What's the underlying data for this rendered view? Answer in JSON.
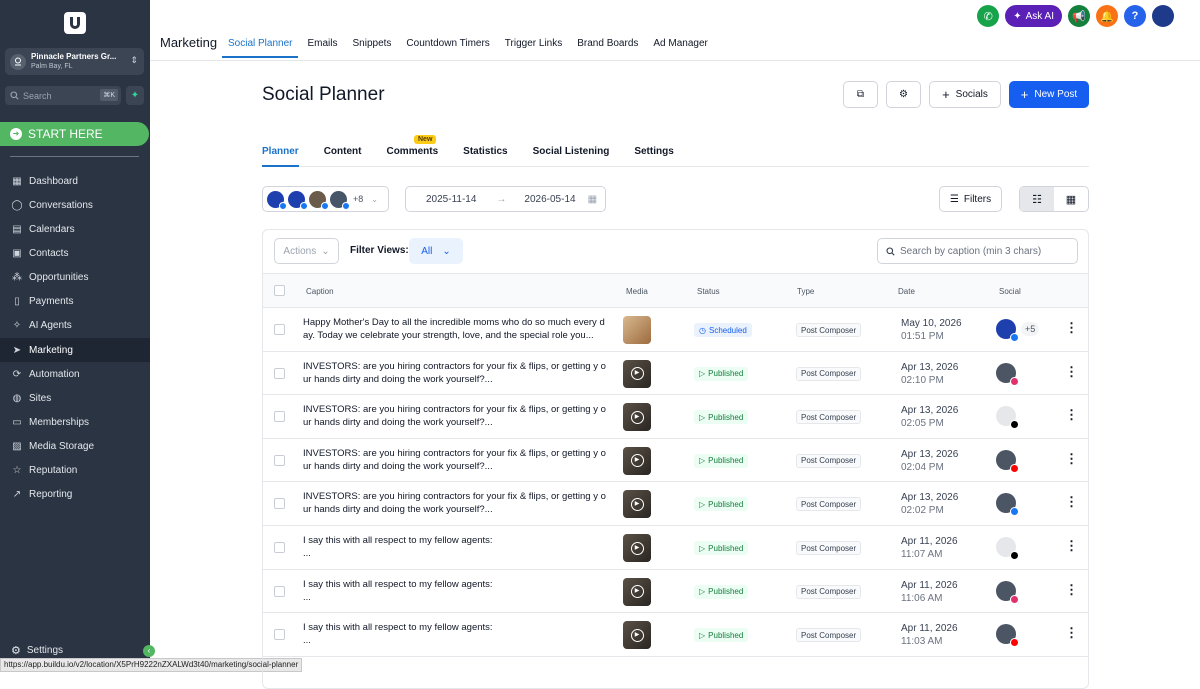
{
  "sidebar": {
    "account_name": "Pinnacle Partners Gr...",
    "account_location": "Palm Bay, FL",
    "search_placeholder": "Search",
    "search_shortcut": "⌘K",
    "start_here": "START HERE",
    "items": [
      {
        "label": "Dashboard",
        "icon": "dashboard-icon"
      },
      {
        "label": "Conversations",
        "icon": "chat-icon"
      },
      {
        "label": "Calendars",
        "icon": "calendar-icon"
      },
      {
        "label": "Contacts",
        "icon": "contacts-icon"
      },
      {
        "label": "Opportunities",
        "icon": "opportunities-icon"
      },
      {
        "label": "Payments",
        "icon": "payments-icon"
      },
      {
        "label": "AI Agents",
        "icon": "ai-agents-icon"
      },
      {
        "label": "Marketing",
        "icon": "send-icon",
        "active": true
      },
      {
        "label": "Automation",
        "icon": "automation-icon"
      },
      {
        "label": "Sites",
        "icon": "globe-icon"
      },
      {
        "label": "Memberships",
        "icon": "memberships-icon"
      },
      {
        "label": "Media Storage",
        "icon": "media-icon"
      },
      {
        "label": "Reputation",
        "icon": "star-icon"
      },
      {
        "label": "Reporting",
        "icon": "chart-icon"
      }
    ],
    "settings_label": "Settings"
  },
  "status_url": "https://app.buildu.io/v2/location/X5PrH9222nZXALWd3t40/marketing/social-planner",
  "topbar": {
    "title": "Marketing",
    "tabs": [
      "Social Planner",
      "Emails",
      "Snippets",
      "Countdown Timers",
      "Trigger Links",
      "Brand Boards",
      "Ad Manager"
    ],
    "ask_ai": "Ask AI"
  },
  "page": {
    "title": "Social Planner",
    "socials_label": "Socials",
    "new_post_label": "New Post",
    "subtabs": [
      "Planner",
      "Content",
      "Comments",
      "Statistics",
      "Social Listening",
      "Settings"
    ],
    "new_badge": "New",
    "avatars_more": "+8",
    "date_start": "2025-11-14",
    "date_end": "2026-05-14",
    "filters_label": "Filters"
  },
  "table": {
    "actions_label": "Actions",
    "filter_views_label": "Filter Views:",
    "filter_views_value": "All",
    "search_placeholder": "Search by caption (min 3 chars)",
    "headers": {
      "caption": "Caption",
      "media": "Media",
      "status": "Status",
      "type": "Type",
      "date": "Date",
      "social": "Social"
    },
    "rows": [
      {
        "caption": "Happy Mother's Day to all the incredible moms who do so much every day. Today we celebrate your strength, love, and the special role you...",
        "status": "Scheduled",
        "type": "Post Composer",
        "date": "May 10, 2026",
        "time": "01:51 PM",
        "social": "multi",
        "more": "+5"
      },
      {
        "caption": "INVESTORS: are you hiring contractors for your fix & flips, or getting y our hands dirty and doing the work yourself?...",
        "status": "Published",
        "type": "Post Composer",
        "date": "Apr 13, 2026",
        "time": "02:10 PM",
        "social": "instagram"
      },
      {
        "caption": "INVESTORS: are you hiring contractors for your fix & flips, or getting y our hands dirty and doing the work yourself?...",
        "status": "Published",
        "type": "Post Composer",
        "date": "Apr 13, 2026",
        "time": "02:05 PM",
        "social": "tiktok"
      },
      {
        "caption": "INVESTORS: are you hiring contractors for your fix & flips, or getting y our hands dirty and doing the work yourself?...",
        "status": "Published",
        "type": "Post Composer",
        "date": "Apr 13, 2026",
        "time": "02:04 PM",
        "social": "youtube"
      },
      {
        "caption": "INVESTORS: are you hiring contractors for your fix & flips, or getting y our hands dirty and doing the work yourself?...",
        "status": "Published",
        "type": "Post Composer",
        "date": "Apr 13, 2026",
        "time": "02:02 PM",
        "social": "facebook"
      },
      {
        "caption": "I say this with all respect to my fellow agents:\n...",
        "status": "Published",
        "type": "Post Composer",
        "date": "Apr 11, 2026",
        "time": "11:07 AM",
        "social": "tiktok"
      },
      {
        "caption": "I say this with all respect to my fellow agents:\n...",
        "status": "Published",
        "type": "Post Composer",
        "date": "Apr 11, 2026",
        "time": "11:06 AM",
        "social": "instagram"
      },
      {
        "caption": "I say this with all respect to my fellow agents:\n...",
        "status": "Published",
        "type": "Post Composer",
        "date": "Apr 11, 2026",
        "time": "11:03 AM",
        "social": "youtube"
      }
    ]
  },
  "colors": {
    "accent": "#155eef",
    "sidebar": "#2b3442",
    "start": "#52b663"
  }
}
